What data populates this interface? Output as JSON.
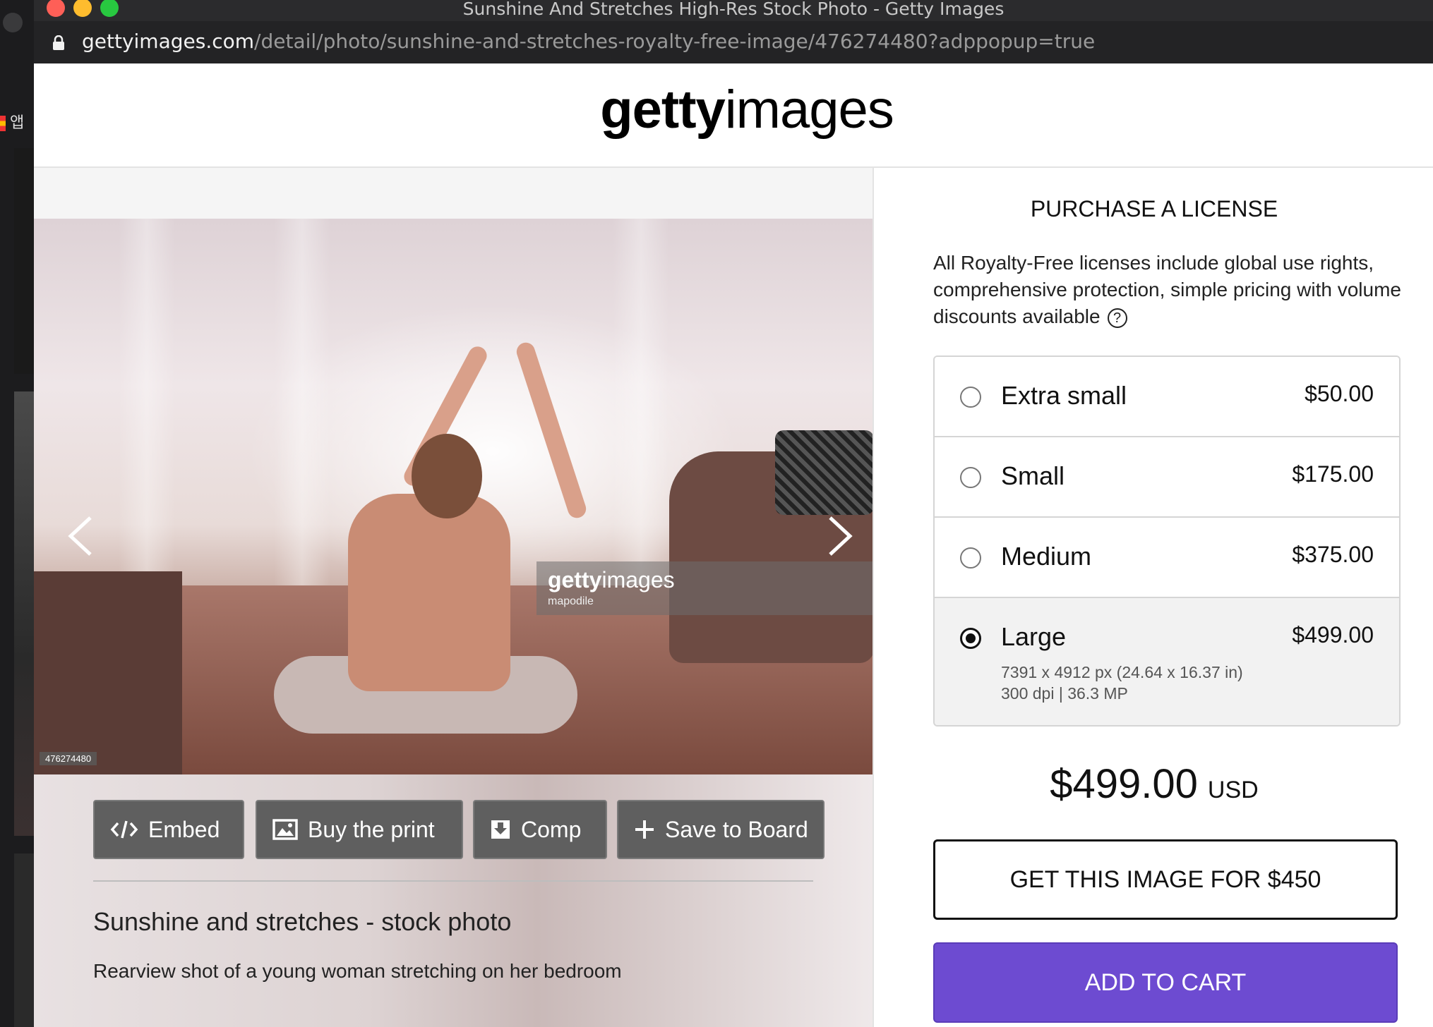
{
  "window": {
    "title": "Sunshine And Stretches High-Res Stock Photo - Getty Images",
    "url_host": "gettyimages.com",
    "url_path": "/detail/photo/sunshine-and-stretches-royalty-free-image/476274480?adppopup=true"
  },
  "behind": {
    "app_label": "앱"
  },
  "header": {
    "logo_bold": "getty",
    "logo_light": "images"
  },
  "photo": {
    "watermark_logo_bold": "getty",
    "watermark_logo_light": "images",
    "watermark_credit": "mapodile",
    "image_id": "476274480"
  },
  "actions": {
    "embed": "Embed",
    "buy_print": "Buy the print",
    "comp": "Comp",
    "save_board": "Save to Board"
  },
  "details": {
    "title": "Sunshine and stretches - stock photo",
    "description": "Rearview shot of a young woman stretching on her bedroom"
  },
  "license": {
    "heading": "PURCHASE A LICENSE",
    "description": "All Royalty-Free licenses include global use rights, comprehensive protection, simple pricing with volume discounts available",
    "options": [
      {
        "label": "Extra small",
        "price": "$50.00"
      },
      {
        "label": "Small",
        "price": "$175.00"
      },
      {
        "label": "Medium",
        "price": "$375.00"
      },
      {
        "label": "Large",
        "price": "$499.00",
        "dims": "7391 x 4912 px (24.64 x 16.37 in)",
        "dpi": "300 dpi | 36.3 MP"
      }
    ],
    "selected": "Large",
    "total_amount": "$499.00",
    "total_currency": "USD",
    "get_image_label": "GET THIS IMAGE FOR $450",
    "add_to_cart_label": "ADD TO CART"
  },
  "colors": {
    "accent": "#6d4bd1",
    "titlebar": "#2b2b2d"
  }
}
